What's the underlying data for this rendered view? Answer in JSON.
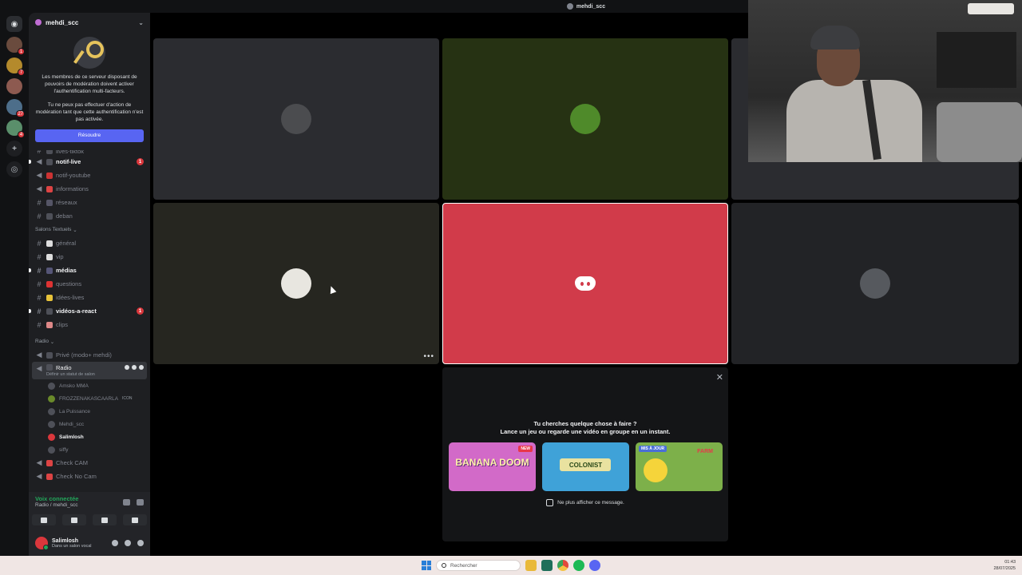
{
  "window": {
    "title": "mehdi_scc"
  },
  "server": {
    "name": "mehdi_scc"
  },
  "rail": {
    "servers": [
      {
        "name": "srv1",
        "badge": "1"
      },
      {
        "name": "srv2",
        "badge": "7"
      },
      {
        "name": "srv3",
        "badge": ""
      },
      {
        "name": "srv4",
        "badge": "27"
      },
      {
        "name": "srv5",
        "badge": "4"
      }
    ]
  },
  "mfa": {
    "text1": "Les membres de ce serveur disposant de pouvoirs de modération doivent activer l'authentification multi-facteurs.",
    "text2": "Tu ne peux pas effectuer d'action de modération tant que cette authentification n'est pas activée.",
    "button": "Résoudre"
  },
  "channels": {
    "top": [
      {
        "name": "lives-tiktok"
      },
      {
        "name": "notif-live",
        "bold": true,
        "unread": "1"
      },
      {
        "name": "notif-youtube"
      },
      {
        "name": "informations"
      },
      {
        "name": "réseaux"
      },
      {
        "name": "deban"
      }
    ],
    "category_text": "Salons Textuels",
    "text": [
      {
        "name": "général"
      },
      {
        "name": "vip"
      },
      {
        "name": "médias",
        "bold": true
      },
      {
        "name": "questions"
      },
      {
        "name": "idées-lives"
      },
      {
        "name": "vidéos-a-react",
        "bold": true,
        "unread": "1"
      },
      {
        "name": "clips"
      }
    ],
    "category_radio": "Radio",
    "private": "Privé (modo+ mehdi)",
    "radio": "Radio",
    "radio_status": "Définir un statut de salon",
    "voice_users": [
      {
        "name": "Amsko MMA"
      },
      {
        "name": "FROZZENAKASCAARLA",
        "tag": "ICON"
      },
      {
        "name": "La Puissance"
      },
      {
        "name": "Mehdi_scc"
      },
      {
        "name": "Salimlosh",
        "me": true
      },
      {
        "name": "siffy"
      }
    ],
    "check_cam": "Check CAM",
    "check_no_cam": "Check No Cam"
  },
  "voice_panel": {
    "status": "Voix connectée",
    "channel": "Radio / mehdi_scc"
  },
  "user": {
    "name": "Salimlosh",
    "status": "Dans un salon vocal"
  },
  "activity": {
    "title_line1": "Tu cherches quelque chose à faire ?",
    "title_line2": "Lance un jeu ou regarde une vidéo en groupe en un instant.",
    "cards": [
      {
        "label": "BANANA DOOM",
        "badge": "NEW"
      },
      {
        "label": "COLONIST",
        "badge": ""
      },
      {
        "label": "FARM",
        "badge": "MIS À JOUR"
      }
    ],
    "dont_show": "Ne plus afficher ce message."
  },
  "taskbar": {
    "search_placeholder": "Rechercher",
    "time": "01:43",
    "date": "28/07/2025"
  },
  "colors": {
    "accent": "#5865f2",
    "highlight_tile": "#d13b4a",
    "connected": "#23a55a"
  }
}
